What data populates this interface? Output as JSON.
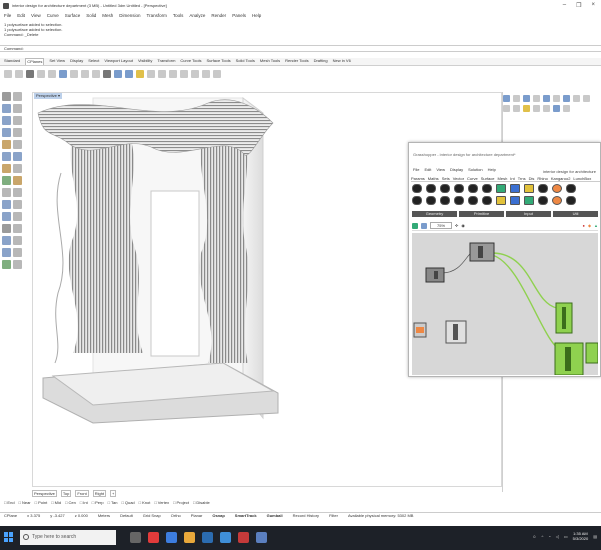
{
  "window": {
    "title": "interior design for architecture department (3 MB) - Untitled 3dm Untitled - [Perspective]",
    "controls": [
      "–",
      "❐",
      "×"
    ]
  },
  "menu": [
    "File",
    "Edit",
    "View",
    "Curve",
    "Surface",
    "Solid",
    "Mesh",
    "Dimension",
    "Transform",
    "Tools",
    "Analyze",
    "Render",
    "Panels",
    "Help"
  ],
  "command_history": [
    "1 polysurface added to selection.",
    "1 polysurface added to selection.",
    "Command: _Delete"
  ],
  "command_prompt": "Command:",
  "toolbar_tabs": [
    "Standard",
    "CPlanes",
    "Set View",
    "Display",
    "Select",
    "Viewport Layout",
    "Visibility",
    "Transform",
    "Curve Tools",
    "Surface Tools",
    "Solid Tools",
    "Mesh Tools",
    "Render Tools",
    "Drafting",
    "New in V6"
  ],
  "active_toolbar_tab": "CPlanes",
  "viewport": {
    "label": "Perspective ▾"
  },
  "grasshopper": {
    "title": "Grasshopper - interior design for architecture department*",
    "document": "interior design for architecture",
    "menu": [
      "File",
      "Edit",
      "View",
      "Display",
      "Solution",
      "Help"
    ],
    "tabs": [
      "Params",
      "Maths",
      "Sets",
      "Vector",
      "Curve",
      "Surface",
      "Mesh",
      "Int",
      "Trns",
      "Dis",
      "Rhino",
      "Kangaroo2",
      "LunchBox"
    ],
    "categories": [
      "Geometry",
      "Primitive",
      "Input",
      "Util"
    ],
    "zoom": "75%",
    "accent_green": "#8fd14f"
  },
  "view_tabs": [
    "Perspective",
    "Top",
    "Front",
    "Right",
    "+"
  ],
  "osnaps": [
    "End",
    "Near",
    "Point",
    "Mid",
    "Cen",
    "Int",
    "Perp",
    "Tan",
    "Quad",
    "Knot",
    "Vertex",
    "Project",
    "Disable"
  ],
  "status": {
    "cplane": "CPlane",
    "x": "x 3.375",
    "y": "y -3.427",
    "z": "z 0.000",
    "units": "Meters",
    "layer": "Default",
    "items": [
      "Grid Snap",
      "Ortho",
      "Planar",
      "Osnap",
      "SmartTrack",
      "Gumball",
      "Record History",
      "Filter",
      "Available physical memory: 5302 MB"
    ]
  },
  "taskbar": {
    "search_placeholder": "Type here to search",
    "time": "1:35 AM",
    "date": "5/3/2020"
  }
}
